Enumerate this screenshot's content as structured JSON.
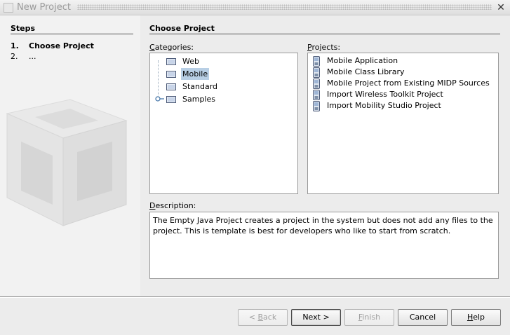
{
  "window": {
    "title": "New Project",
    "close_glyph": "✕"
  },
  "steps": {
    "title": "Steps",
    "items": [
      {
        "num": "1.",
        "label": "Choose Project"
      },
      {
        "num": "2.",
        "label": "..."
      }
    ]
  },
  "main": {
    "title": "Choose Project",
    "categories_label": "ategories:",
    "categories_mnemonic": "C",
    "categories": [
      "Web",
      "Mobile",
      "Standard",
      "Samples"
    ],
    "selected_category": "Mobile",
    "projects_label": "rojects:",
    "projects_mnemonic": "P",
    "projects": [
      "Mobile Application",
      "Mobile Class Library",
      "Mobile Project from Existing MIDP Sources",
      "Import Wireless Toolkit Project",
      "Import Mobility Studio Project"
    ],
    "description_label": "escription:",
    "description_mnemonic": "D",
    "description": "The Empty Java Project creates a project in the system but does not add any files to the project. This is template is best for developers who like to start from scratch."
  },
  "buttons": {
    "back": "< Back",
    "back_mn": "B",
    "next": "Next >",
    "finish": "Finish",
    "finish_mn": "F",
    "cancel": "Cancel",
    "help": "Help",
    "help_mn": "H"
  },
  "icons": {
    "folder": "folder-icon",
    "phone": "mobile-project-icon",
    "window": "window-icon",
    "close": "close-icon",
    "expand": "tree-expand-handle-icon"
  }
}
